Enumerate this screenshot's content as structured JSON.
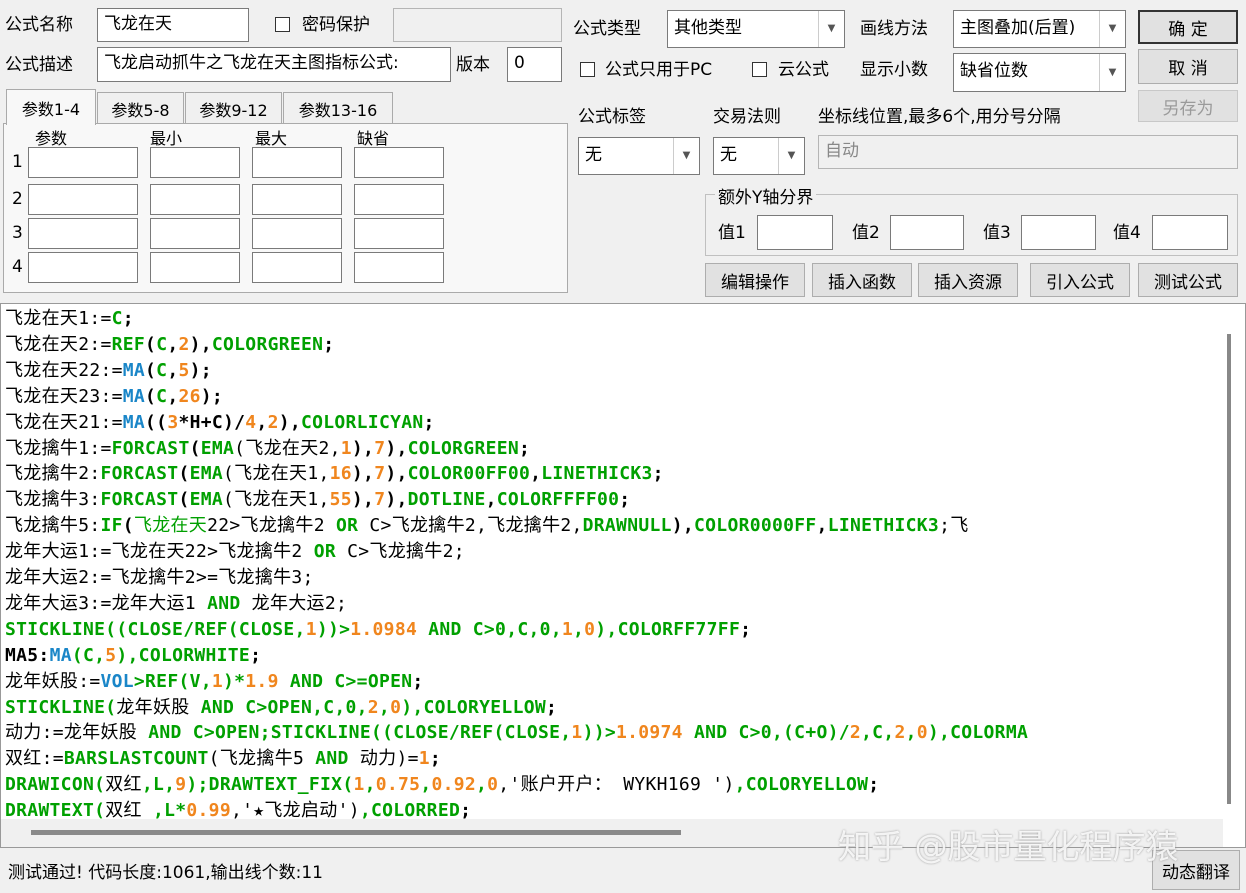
{
  "form": {
    "name_label": "公式名称",
    "name_value": "飞龙在天",
    "password_label": "密码保护",
    "password_checked": false,
    "desc_label": "公式描述",
    "desc_value": "飞龙启动抓牛之飞龙在天主图指标公式:",
    "version_label": "版本",
    "version_value": "0",
    "type_label": "公式类型",
    "type_value": "其他类型",
    "draw_label": "画线方法",
    "draw_value": "主图叠加(后置)",
    "pc_only_label": "公式只用于PC",
    "cloud_label": "云公式",
    "decimal_label": "显示小数",
    "decimal_value": "缺省位数",
    "tag_label": "公式标签",
    "tag_value": "无",
    "rule_label": "交易法则",
    "rule_value": "无",
    "coord_label": "坐标线位置,最多6个,用分号分隔",
    "coord_value": "自动",
    "yaxis_group": "额外Y轴分界",
    "yaxis_labels": [
      "值1",
      "值2",
      "值3",
      "值4"
    ]
  },
  "buttons": {
    "ok": "确  定",
    "cancel": "取  消",
    "save_as": "另存为",
    "edit": "编辑操作",
    "insert_func": "插入函数",
    "insert_res": "插入资源",
    "import": "引入公式",
    "test": "测试公式",
    "translate": "动态翻译"
  },
  "params": {
    "tabs": [
      "参数1-4",
      "参数5-8",
      "参数9-12",
      "参数13-16"
    ],
    "headers": [
      "参数",
      "最小",
      "最大",
      "缺省"
    ],
    "rows": [
      "1",
      "2",
      "3",
      "4"
    ]
  },
  "colors": {
    "k": "#000000",
    "g": "#00a000",
    "b": "#1a86c8",
    "o": "#f0861e"
  },
  "code_lines": [
    [
      [
        "飞龙在天1:=",
        "k"
      ],
      [
        "C",
        "g"
      ],
      [
        ";",
        "k"
      ]
    ],
    [
      [
        "飞龙在天2:=",
        "k"
      ],
      [
        "REF",
        "g"
      ],
      [
        "(",
        "k"
      ],
      [
        "C",
        "g"
      ],
      [
        ",",
        "k"
      ],
      [
        "2",
        "o"
      ],
      [
        "),",
        "k"
      ],
      [
        "COLORGREEN",
        "g"
      ],
      [
        ";",
        "k"
      ]
    ],
    [
      [
        "飞龙在天22:=",
        "k"
      ],
      [
        "MA",
        "b"
      ],
      [
        "(",
        "k"
      ],
      [
        "C",
        "g"
      ],
      [
        ",",
        "k"
      ],
      [
        "5",
        "o"
      ],
      [
        ");",
        "k"
      ]
    ],
    [
      [
        "飞龙在天23:=",
        "k"
      ],
      [
        "MA",
        "b"
      ],
      [
        "(",
        "k"
      ],
      [
        "C",
        "g"
      ],
      [
        ",",
        "k"
      ],
      [
        "26",
        "o"
      ],
      [
        ");",
        "k"
      ]
    ],
    [
      [
        "飞龙在天21:=",
        "k"
      ],
      [
        "MA",
        "b"
      ],
      [
        "((",
        "k"
      ],
      [
        "3",
        "o"
      ],
      [
        "*H+C)/",
        "k"
      ],
      [
        "4",
        "o"
      ],
      [
        ",",
        "k"
      ],
      [
        "2",
        "o"
      ],
      [
        "),",
        "k"
      ],
      [
        "COLORLICYAN",
        "g"
      ],
      [
        ";",
        "k"
      ]
    ],
    [
      [
        "飞龙擒牛1:=",
        "k"
      ],
      [
        "FORCAST",
        "g"
      ],
      [
        "(",
        "k"
      ],
      [
        "EMA",
        "g"
      ],
      [
        "(飞龙在天2,",
        "k"
      ],
      [
        "1",
        "o"
      ],
      [
        "),",
        "k"
      ],
      [
        "7",
        "o"
      ],
      [
        "),",
        "k"
      ],
      [
        "COLORGREEN",
        "g"
      ],
      [
        ";",
        "k"
      ]
    ],
    [
      [
        "飞龙擒牛2:",
        "k"
      ],
      [
        "FORCAST",
        "g"
      ],
      [
        "(",
        "k"
      ],
      [
        "EMA",
        "g"
      ],
      [
        "(飞龙在天1,",
        "k"
      ],
      [
        "16",
        "o"
      ],
      [
        "),",
        "k"
      ],
      [
        "7",
        "o"
      ],
      [
        "),",
        "k"
      ],
      [
        "COLOR00FF00",
        "g"
      ],
      [
        ",",
        "k"
      ],
      [
        "LINETHICK3",
        "g"
      ],
      [
        ";",
        "k"
      ]
    ],
    [
      [
        "飞龙擒牛3:",
        "k"
      ],
      [
        "FORCAST",
        "g"
      ],
      [
        "(",
        "k"
      ],
      [
        "EMA",
        "g"
      ],
      [
        "(飞龙在天1,",
        "k"
      ],
      [
        "55",
        "o"
      ],
      [
        "),",
        "k"
      ],
      [
        "7",
        "o"
      ],
      [
        "),",
        "k"
      ],
      [
        "DOTLINE",
        "g"
      ],
      [
        ",",
        "k"
      ],
      [
        "COLORFFFF00",
        "g"
      ],
      [
        ";",
        "k"
      ]
    ],
    [
      [
        "飞龙擒牛5:",
        "k"
      ],
      [
        "IF",
        "g"
      ],
      [
        "(",
        "k"
      ],
      [
        "飞龙在天",
        "g"
      ],
      [
        "22>飞龙擒牛2 ",
        "k"
      ],
      [
        "OR",
        "g"
      ],
      [
        " C>飞龙擒牛2,飞龙擒牛2,",
        "k"
      ],
      [
        "DRAWNULL",
        "g"
      ],
      [
        "),",
        "k"
      ],
      [
        "COLOR0000FF",
        "g"
      ],
      [
        ",",
        "k"
      ],
      [
        "LINETHICK3",
        "g"
      ],
      [
        ";飞",
        "k"
      ]
    ],
    [
      [
        "龙年大运1:=飞龙在天22>飞龙擒牛2 ",
        "k"
      ],
      [
        "OR",
        "g"
      ],
      [
        " C>飞龙擒牛2;",
        "k"
      ]
    ],
    [
      [
        "龙年大运2:=飞龙擒牛2>=飞龙擒牛3;",
        "k"
      ]
    ],
    [
      [
        "龙年大运3:=龙年大运1 ",
        "k"
      ],
      [
        "AND",
        "g"
      ],
      [
        " 龙年大运2;",
        "k"
      ]
    ],
    [
      [
        "STICKLINE((CLOSE/REF(CLOSE,",
        "g"
      ],
      [
        "1",
        "o"
      ],
      [
        "))>",
        "g"
      ],
      [
        "1.0984",
        "o"
      ],
      [
        " AND C>0,C,0,",
        "g"
      ],
      [
        "1",
        "o"
      ],
      [
        ",",
        "g"
      ],
      [
        "0",
        "o"
      ],
      [
        "),COLORFF77FF",
        "g"
      ],
      [
        ";",
        "k"
      ]
    ],
    [
      [
        "MA5:",
        "k"
      ],
      [
        "MA",
        "b"
      ],
      [
        "(C,",
        "g"
      ],
      [
        "5",
        "o"
      ],
      [
        "),COLORWHITE",
        "g"
      ],
      [
        ";",
        "k"
      ]
    ],
    [
      [
        "龙年妖股:=",
        "k"
      ],
      [
        "VOL",
        "b"
      ],
      [
        ">REF(V,",
        "g"
      ],
      [
        "1",
        "o"
      ],
      [
        ")*",
        "g"
      ],
      [
        "1.9",
        "o"
      ],
      [
        " AND C>=OPEN",
        "g"
      ],
      [
        ";",
        "k"
      ]
    ],
    [
      [
        "STICKLINE(",
        "g"
      ],
      [
        "龙年妖股",
        "k"
      ],
      [
        " AND C>OPEN,C,0,",
        "g"
      ],
      [
        "2",
        "o"
      ],
      [
        ",",
        "g"
      ],
      [
        "0",
        "o"
      ],
      [
        "),COLORYELLOW",
        "g"
      ],
      [
        ";",
        "k"
      ]
    ],
    [
      [
        "动力:=龙年妖股",
        "k"
      ],
      [
        " AND C>OPEN;STICKLINE((CLOSE/REF(CLOSE,",
        "g"
      ],
      [
        "1",
        "o"
      ],
      [
        "))>",
        "g"
      ],
      [
        "1.0974",
        "o"
      ],
      [
        " AND C>0,(C+O)/",
        "g"
      ],
      [
        "2",
        "o"
      ],
      [
        ",C,",
        "g"
      ],
      [
        "2",
        "o"
      ],
      [
        ",",
        "g"
      ],
      [
        "0",
        "o"
      ],
      [
        "),COLORMA",
        "g"
      ]
    ],
    [
      [
        "双红:=",
        "k"
      ],
      [
        "BARSLASTCOUNT",
        "g"
      ],
      [
        "(飞龙擒牛5 ",
        "k"
      ],
      [
        "AND",
        "g"
      ],
      [
        " 动力)=",
        "k"
      ],
      [
        "1",
        "o"
      ],
      [
        ";",
        "k"
      ]
    ],
    [
      [
        "DRAWICON(",
        "g"
      ],
      [
        "双红",
        "k"
      ],
      [
        ",L,",
        "g"
      ],
      [
        "9",
        "o"
      ],
      [
        ");DRAWTEXT_FIX(",
        "g"
      ],
      [
        "1",
        "o"
      ],
      [
        ",",
        "g"
      ],
      [
        "0.75",
        "o"
      ],
      [
        ",",
        "g"
      ],
      [
        "0.92",
        "o"
      ],
      [
        ",",
        "g"
      ],
      [
        "0",
        "o"
      ],
      [
        ",'账户开户： WYKH169 ')",
        "k"
      ],
      [
        ",COLORYELLOW",
        "g"
      ],
      [
        ";",
        "k"
      ]
    ],
    [
      [
        "DRAWTEXT(",
        "g"
      ],
      [
        "双红",
        "k"
      ],
      [
        " ,L*",
        "g"
      ],
      [
        "0.99",
        "o"
      ],
      [
        ",'★飞龙启动')",
        "k"
      ],
      [
        ",COLORRED",
        "g"
      ],
      [
        ";",
        "k"
      ]
    ]
  ],
  "status": "测试通过! 代码长度:1061,输出线个数:11",
  "watermark": "知乎 @股市量化程序猿"
}
